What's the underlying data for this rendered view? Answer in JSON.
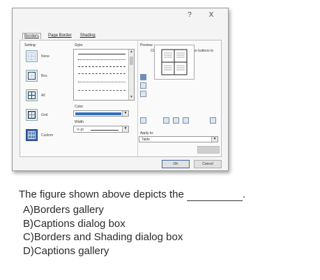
{
  "dialog": {
    "title_help": "?",
    "title_close": "X",
    "tabs": [
      {
        "label": "Borders",
        "active": true
      },
      {
        "label": "Page Border",
        "active": false
      },
      {
        "label": "Shading",
        "active": false
      }
    ],
    "setting_label": "Setting:",
    "settings": [
      {
        "label": "None",
        "icon": "none-border-icon"
      },
      {
        "label": "Box",
        "icon": "box-border-icon"
      },
      {
        "label": "All",
        "icon": "all-borders-icon"
      },
      {
        "label": "Grid",
        "icon": "grid-border-icon"
      },
      {
        "label": "Custom",
        "icon": "custom-border-icon",
        "selected": true
      }
    ],
    "style_label": "Style:",
    "color_label": "Color:",
    "color_value": "#2f6fc2",
    "width_label": "Width:",
    "width_value": "½ pt",
    "preview_label": "Preview",
    "preview_instructions": "Click on diagram below or use buttons to apply borders",
    "apply_to_label": "Apply to:",
    "apply_to_value": "Table",
    "ok_label": "OK",
    "cancel_label": "Cancel"
  },
  "question": {
    "text": "The figure shown above depicts the",
    "end": "."
  },
  "options": [
    "A)Borders gallery",
    "B)Captions dialog box",
    "C)Borders and Shading dialog box",
    "D)Captions gallery"
  ]
}
